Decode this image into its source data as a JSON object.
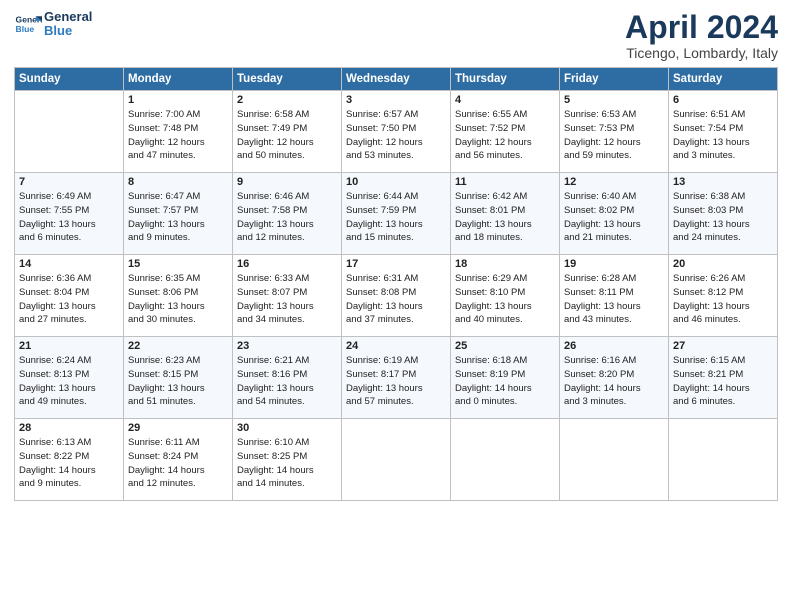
{
  "header": {
    "logo_line1": "General",
    "logo_line2": "Blue",
    "title": "April 2024",
    "subtitle": "Ticengo, Lombardy, Italy"
  },
  "weekdays": [
    "Sunday",
    "Monday",
    "Tuesday",
    "Wednesday",
    "Thursday",
    "Friday",
    "Saturday"
  ],
  "weeks": [
    [
      {
        "day": "",
        "content": ""
      },
      {
        "day": "1",
        "content": "Sunrise: 7:00 AM\nSunset: 7:48 PM\nDaylight: 12 hours\nand 47 minutes."
      },
      {
        "day": "2",
        "content": "Sunrise: 6:58 AM\nSunset: 7:49 PM\nDaylight: 12 hours\nand 50 minutes."
      },
      {
        "day": "3",
        "content": "Sunrise: 6:57 AM\nSunset: 7:50 PM\nDaylight: 12 hours\nand 53 minutes."
      },
      {
        "day": "4",
        "content": "Sunrise: 6:55 AM\nSunset: 7:52 PM\nDaylight: 12 hours\nand 56 minutes."
      },
      {
        "day": "5",
        "content": "Sunrise: 6:53 AM\nSunset: 7:53 PM\nDaylight: 12 hours\nand 59 minutes."
      },
      {
        "day": "6",
        "content": "Sunrise: 6:51 AM\nSunset: 7:54 PM\nDaylight: 13 hours\nand 3 minutes."
      }
    ],
    [
      {
        "day": "7",
        "content": "Sunrise: 6:49 AM\nSunset: 7:55 PM\nDaylight: 13 hours\nand 6 minutes."
      },
      {
        "day": "8",
        "content": "Sunrise: 6:47 AM\nSunset: 7:57 PM\nDaylight: 13 hours\nand 9 minutes."
      },
      {
        "day": "9",
        "content": "Sunrise: 6:46 AM\nSunset: 7:58 PM\nDaylight: 13 hours\nand 12 minutes."
      },
      {
        "day": "10",
        "content": "Sunrise: 6:44 AM\nSunset: 7:59 PM\nDaylight: 13 hours\nand 15 minutes."
      },
      {
        "day": "11",
        "content": "Sunrise: 6:42 AM\nSunset: 8:01 PM\nDaylight: 13 hours\nand 18 minutes."
      },
      {
        "day": "12",
        "content": "Sunrise: 6:40 AM\nSunset: 8:02 PM\nDaylight: 13 hours\nand 21 minutes."
      },
      {
        "day": "13",
        "content": "Sunrise: 6:38 AM\nSunset: 8:03 PM\nDaylight: 13 hours\nand 24 minutes."
      }
    ],
    [
      {
        "day": "14",
        "content": "Sunrise: 6:36 AM\nSunset: 8:04 PM\nDaylight: 13 hours\nand 27 minutes."
      },
      {
        "day": "15",
        "content": "Sunrise: 6:35 AM\nSunset: 8:06 PM\nDaylight: 13 hours\nand 30 minutes."
      },
      {
        "day": "16",
        "content": "Sunrise: 6:33 AM\nSunset: 8:07 PM\nDaylight: 13 hours\nand 34 minutes."
      },
      {
        "day": "17",
        "content": "Sunrise: 6:31 AM\nSunset: 8:08 PM\nDaylight: 13 hours\nand 37 minutes."
      },
      {
        "day": "18",
        "content": "Sunrise: 6:29 AM\nSunset: 8:10 PM\nDaylight: 13 hours\nand 40 minutes."
      },
      {
        "day": "19",
        "content": "Sunrise: 6:28 AM\nSunset: 8:11 PM\nDaylight: 13 hours\nand 43 minutes."
      },
      {
        "day": "20",
        "content": "Sunrise: 6:26 AM\nSunset: 8:12 PM\nDaylight: 13 hours\nand 46 minutes."
      }
    ],
    [
      {
        "day": "21",
        "content": "Sunrise: 6:24 AM\nSunset: 8:13 PM\nDaylight: 13 hours\nand 49 minutes."
      },
      {
        "day": "22",
        "content": "Sunrise: 6:23 AM\nSunset: 8:15 PM\nDaylight: 13 hours\nand 51 minutes."
      },
      {
        "day": "23",
        "content": "Sunrise: 6:21 AM\nSunset: 8:16 PM\nDaylight: 13 hours\nand 54 minutes."
      },
      {
        "day": "24",
        "content": "Sunrise: 6:19 AM\nSunset: 8:17 PM\nDaylight: 13 hours\nand 57 minutes."
      },
      {
        "day": "25",
        "content": "Sunrise: 6:18 AM\nSunset: 8:19 PM\nDaylight: 14 hours\nand 0 minutes."
      },
      {
        "day": "26",
        "content": "Sunrise: 6:16 AM\nSunset: 8:20 PM\nDaylight: 14 hours\nand 3 minutes."
      },
      {
        "day": "27",
        "content": "Sunrise: 6:15 AM\nSunset: 8:21 PM\nDaylight: 14 hours\nand 6 minutes."
      }
    ],
    [
      {
        "day": "28",
        "content": "Sunrise: 6:13 AM\nSunset: 8:22 PM\nDaylight: 14 hours\nand 9 minutes."
      },
      {
        "day": "29",
        "content": "Sunrise: 6:11 AM\nSunset: 8:24 PM\nDaylight: 14 hours\nand 12 minutes."
      },
      {
        "day": "30",
        "content": "Sunrise: 6:10 AM\nSunset: 8:25 PM\nDaylight: 14 hours\nand 14 minutes."
      },
      {
        "day": "",
        "content": ""
      },
      {
        "day": "",
        "content": ""
      },
      {
        "day": "",
        "content": ""
      },
      {
        "day": "",
        "content": ""
      }
    ]
  ]
}
